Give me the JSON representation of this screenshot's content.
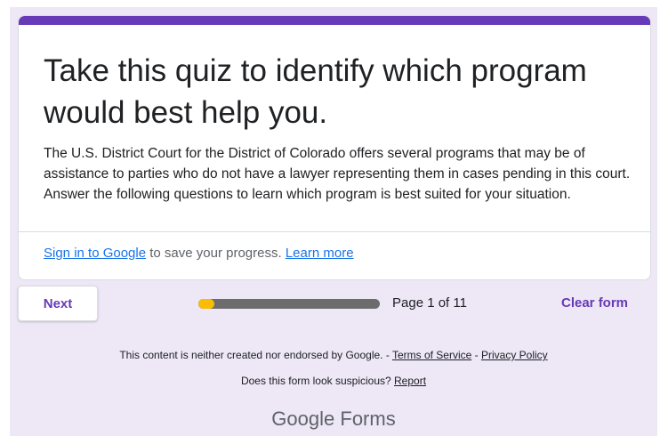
{
  "form": {
    "title": "Take this quiz to identify which program would best help you.",
    "description": "The U.S. District Court for the District of Colorado offers several programs that may be of assistance to parties who do not have a lawyer representing them in cases pending in this court.  Answer the following questions to learn which program is best suited for your situation.",
    "accent_color": "#673ab7"
  },
  "signin": {
    "link_label": "Sign in to Google",
    "text": " to save your progress. ",
    "learn_more_label": "Learn more"
  },
  "navigation": {
    "next_label": "Next",
    "progress_fraction": 0.09,
    "progress_color": "#fbbc04",
    "page_indicator": "Page 1 of 11",
    "clear_label": "Clear form"
  },
  "footer": {
    "disclaimer": "This content is neither created nor endorsed by Google. - ",
    "terms_label": "Terms of Service",
    "separator": " - ",
    "privacy_label": "Privacy Policy",
    "suspicious_text": "Does this form look suspicious? ",
    "report_label": "Report",
    "brand_google": "Google",
    "brand_forms": "Forms"
  }
}
